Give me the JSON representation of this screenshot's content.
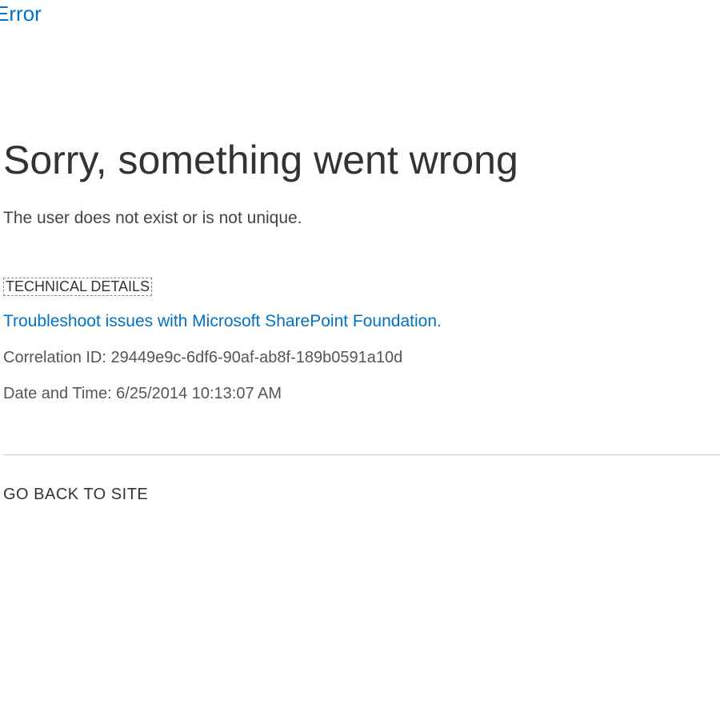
{
  "header": {
    "title": "Error"
  },
  "error": {
    "heading": "Sorry, something went wrong",
    "message": "The user does not exist or is not unique.",
    "technicalDetailsLabel": "TECHNICAL DETAILS",
    "troubleshootLink": "Troubleshoot issues with Microsoft SharePoint Foundation.",
    "correlationId": "Correlation ID: 29449e9c-6df6-90af-ab8f-189b0591a10d",
    "datetime": "Date and Time: 6/25/2014 10:13:07 AM",
    "goBackLink": "GO BACK TO SITE"
  }
}
